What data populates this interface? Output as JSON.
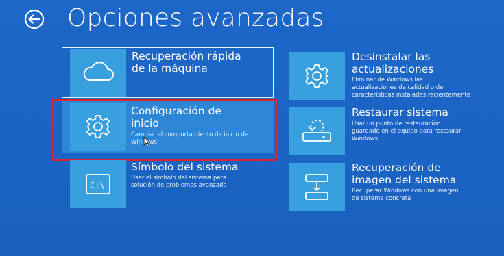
{
  "header": {
    "title": "Opciones avanzadas",
    "back_icon": "back-arrow-icon"
  },
  "options": [
    {
      "id": "quick-recovery",
      "icon": "cloud-icon",
      "title_line1": "Recuperación rápida",
      "title_line2": "de la máquina",
      "desc_line1": "",
      "desc_line2": ""
    },
    {
      "id": "uninstall-updates",
      "icon": "gear-icon",
      "title_line1": "Desinstalar las",
      "title_line2": "actualizaciones",
      "desc_line1": "Eliminar de Windows las",
      "desc_line2": "actualizaciones de calidad o de",
      "desc_line3": "características instaladas recientemente"
    },
    {
      "id": "startup-settings",
      "icon": "gear-icon",
      "title_line1": "Configuración de",
      "title_line2": "inicio",
      "desc_line1": "Cambiar el comportamiento de inicio de",
      "desc_line2": "Windows"
    },
    {
      "id": "system-restore",
      "icon": "restore-icon",
      "title_line1": "Restaurar sistema",
      "desc_line1": "Usar un punto de restauración",
      "desc_line2": "guardado en el equipo para restaurar",
      "desc_line3": "Windows"
    },
    {
      "id": "command-prompt",
      "icon": "command-prompt-icon",
      "title_line1": "Símbolo del sistema",
      "desc_line1": "Usar el símbolo del sistema para",
      "desc_line2": "solución de problemas avanzada"
    },
    {
      "id": "system-image-recovery",
      "icon": "system-image-icon",
      "title_line1": "Recuperación de",
      "title_line2": "imagen del sistema",
      "desc_line1": "Recuperar Windows con una imagen",
      "desc_line2": "de sistema concreta"
    }
  ],
  "colors": {
    "background": "#1b64c4",
    "tile": "#38a0df",
    "highlight": "#d8262c"
  }
}
